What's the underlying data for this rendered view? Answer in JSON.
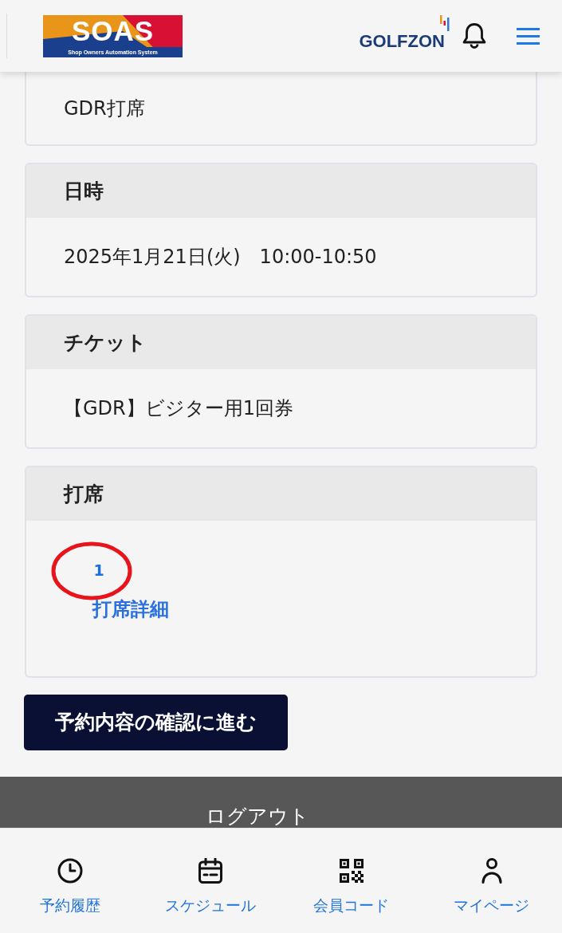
{
  "header": {
    "logo": {
      "title": "SOAS",
      "tagline": "Shop Owners Automation System"
    },
    "brand": "GOLFZON"
  },
  "sections": [
    {
      "kind": "text",
      "value": "GDR打席"
    },
    {
      "kind": "text",
      "title": "日時",
      "value": "2025年1月21日(火)　10:00-10:50"
    },
    {
      "kind": "text",
      "title": "チケット",
      "value": "【GDR】ビジター用1回券"
    },
    {
      "kind": "seats",
      "title": "打席",
      "seats": [
        {
          "number": "1",
          "circled": true,
          "detail_link": "打席詳細"
        }
      ]
    }
  ],
  "primary_button": "予約内容の確認に進む",
  "footer": {
    "logout": "ログアウト"
  },
  "bottom_nav": [
    {
      "label": "予約履歴"
    },
    {
      "label": "スケジュール"
    },
    {
      "label": "会員コード"
    },
    {
      "label": "マイページ"
    }
  ]
}
